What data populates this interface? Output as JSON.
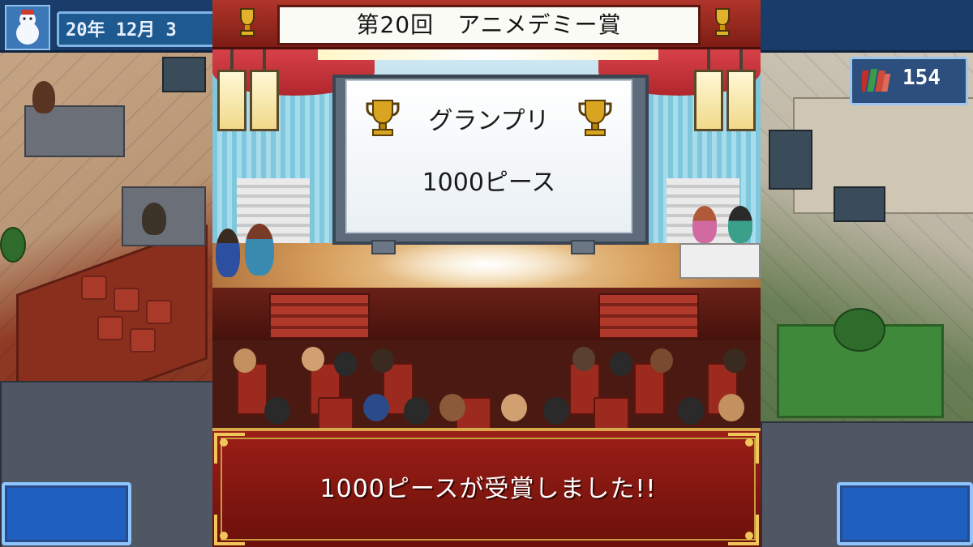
{
  "hud": {
    "date": "20年 12月 3",
    "counter": "154",
    "counter_icon": "research-books-icon",
    "season_icon": "snowman-icon"
  },
  "ceremony": {
    "title": "第20回　アニメデミー賞",
    "award_label": "グランプリ",
    "work_title": "1000ピース",
    "message": "1000ピースが受賞しました!!"
  },
  "colors": {
    "dialog_bg": "#8a1a12",
    "dialog_border": "#d8a84a",
    "hud_blue": "#1e5fc0"
  }
}
